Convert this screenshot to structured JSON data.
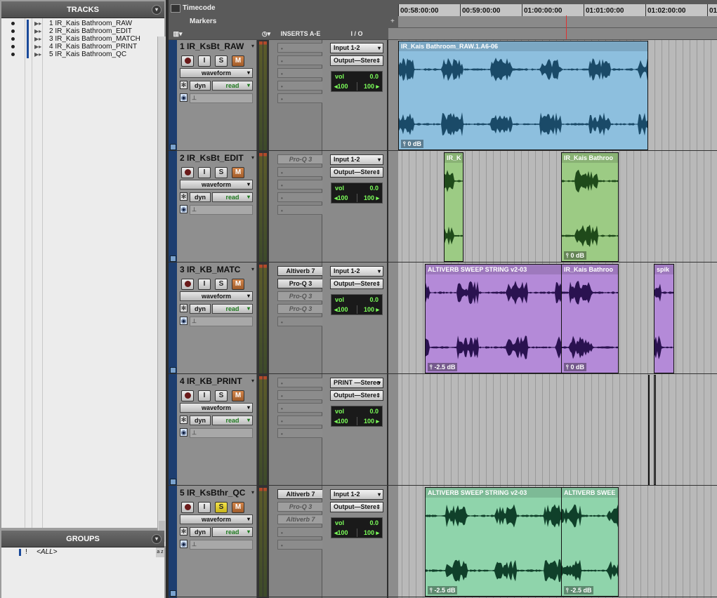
{
  "tracks_panel": {
    "title": "TRACKS"
  },
  "groups_panel": {
    "title": "GROUPS",
    "item": "<ALL>",
    "az": "a z"
  },
  "tracklist": [
    {
      "num": "1",
      "name": "IR_Kais Bathroom_RAW"
    },
    {
      "num": "2",
      "name": "IR_Kais Bathroom_EDIT"
    },
    {
      "num": "3",
      "name": "IR_Kais Bathroom_MATCH"
    },
    {
      "num": "4",
      "name": "IR_Kais Bathroom_PRINT"
    },
    {
      "num": "5",
      "name": "IR_Kais Bathroom_QC"
    }
  ],
  "ruler": {
    "timecode_label": "Timecode",
    "markers_label": "Markers",
    "ticks": [
      "00:58:00:00",
      "00:59:00:00",
      "01:00:00:00",
      "01:01:00:00",
      "01:02:00:00",
      "01"
    ]
  },
  "columns": {
    "inserts": "INSERTS A-E",
    "io": "I / O"
  },
  "track_buttons": {
    "record": "",
    "input": "I",
    "solo": "S",
    "mute": "M",
    "view": "waveform",
    "dyn": "dyn",
    "automation": "read"
  },
  "tracks": [
    {
      "name": "1 IR_KsBt_RAW",
      "solo_active": false,
      "inserts": [
        "",
        "",
        "",
        "",
        ""
      ],
      "input": "Input 1-2",
      "output": "Output—Stere",
      "vol": "vol",
      "vol_value": "0.0",
      "pan_l": "◂100",
      "pan_r": "100 ▸",
      "clips": [
        {
          "name": "IR_Kais Bathroom_RAW.1.A6-06",
          "gain": "0 dB",
          "color": "#8dbfde",
          "wave": "#1a4a68"
        }
      ]
    },
    {
      "name": "2 IR_KsBt_EDIT",
      "solo_active": false,
      "inserts": [
        "Pro-Q 3",
        "",
        "",
        "",
        ""
      ],
      "input": "Input 1-2",
      "output": "Output—Stere",
      "vol": "vol",
      "vol_value": "0.0",
      "pan_l": "◂100",
      "pan_r": "100 ▸",
      "clips": [
        {
          "name": "IR_K",
          "gain": "",
          "color": "#9ccb84",
          "wave": "#1f4a1a"
        },
        {
          "name": "IR_Kais Bathroo",
          "gain": "0 dB",
          "color": "#9ccb84",
          "wave": "#1f4a1a"
        }
      ]
    },
    {
      "name": "3 IR_KB_MATC",
      "solo_active": false,
      "inserts": [
        "Altiverb 7",
        "Pro-Q 3",
        "Pro-Q 3",
        "Pro-Q 3",
        ""
      ],
      "input": "Input 1-2",
      "output": "Output—Stere",
      "vol": "vol",
      "vol_value": "0.0",
      "pan_l": "◂100",
      "pan_r": "100 ▸",
      "clips": [
        {
          "name": "ALTIVERB SWEEP STRING v2-03",
          "gain": "-2.5 dB",
          "color": "#b48ad8",
          "wave": "#2a1250"
        },
        {
          "name": "IR_Kais Bathroo",
          "gain": "0 dB",
          "color": "#b48ad8",
          "wave": "#2a1250"
        },
        {
          "name": "spik",
          "gain": "",
          "color": "#b48ad8",
          "wave": "#2a1250"
        }
      ]
    },
    {
      "name": "4 IR_KB_PRINT",
      "solo_active": false,
      "inserts": [
        "",
        "",
        "",
        "",
        ""
      ],
      "input": "PRINT —Stereo",
      "output": "Output—Stere",
      "vol": "vol",
      "vol_value": "0.0",
      "pan_l": "◂100",
      "pan_r": "100 ▸",
      "clips": []
    },
    {
      "name": "5 IR_KsBthr_QC",
      "solo_active": true,
      "inserts": [
        "Altiverb 7",
        "Pro-Q 3",
        "Altiverb 7",
        "",
        ""
      ],
      "input": "Input 1-2",
      "output": "Output—Stere",
      "vol": "vol",
      "vol_value": "0.0",
      "pan_l": "◂100",
      "pan_r": "100 ▸",
      "clips": [
        {
          "name": "ALTIVERB SWEEP STRING v2-03",
          "gain": "-2.5 dB",
          "color": "#8fd4ab",
          "wave": "#10402a"
        },
        {
          "name": "ALTIVERB SWEE",
          "gain": "-2.5 dB",
          "color": "#8fd4ab",
          "wave": "#10402a"
        }
      ]
    }
  ],
  "colors": {
    "track_side": "#1d3e70",
    "meter_bg": "#333333",
    "playhead": "#e03030"
  }
}
